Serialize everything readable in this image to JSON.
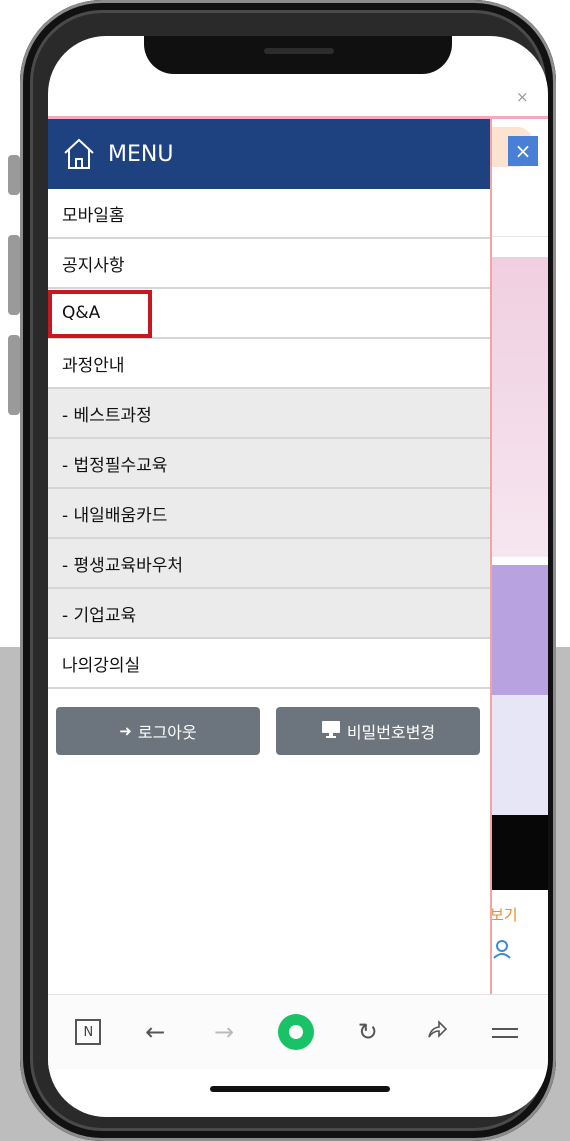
{
  "window": {
    "close_mark": "×"
  },
  "menu": {
    "title": "MENU",
    "items": [
      {
        "label": "모바일홈"
      },
      {
        "label": "공지사항"
      },
      {
        "label": "Q&A"
      },
      {
        "label": "과정안내"
      },
      {
        "label": "- 베스트과정"
      },
      {
        "label": "- 법정필수교육"
      },
      {
        "label": "- 내일배움카드"
      },
      {
        "label": "- 평생교육바우처"
      },
      {
        "label": "- 기업교육"
      },
      {
        "label": "나의강의실"
      }
    ],
    "buttons": {
      "logout": "로그아웃",
      "change_password": "비밀번호변경"
    },
    "close_button": "×"
  },
  "background_page": {
    "see_more": "보기"
  },
  "bottom_nav": {
    "n_icon": "N"
  },
  "colors": {
    "menu_header": "#1e4180",
    "highlight_box": "#c6181f",
    "button_gray": "#6c757d",
    "nav_green": "#19c266"
  },
  "icons": [
    "home-icon",
    "logout-icon",
    "monitor-icon",
    "back-arrow-icon",
    "forward-arrow-icon",
    "reload-icon",
    "share-icon",
    "menu-lines-icon"
  ]
}
